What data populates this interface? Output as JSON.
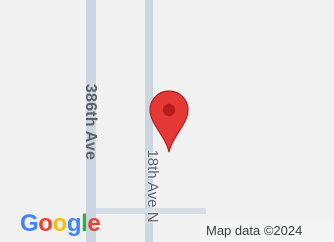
{
  "map": {
    "roads": [
      {
        "name": "386th Ave"
      },
      {
        "name": "18th Ave N"
      }
    ],
    "marker": {
      "icon": "map-pin-icon",
      "color": "#e53935"
    },
    "attribution": "Map data ©2024",
    "logo": {
      "text": "Google",
      "letters": [
        "G",
        "o",
        "o",
        "g",
        "l",
        "e"
      ],
      "colors": [
        "#4285f4",
        "#ea4335",
        "#fbbc05",
        "#4285f4",
        "#34a853",
        "#ea4335"
      ]
    },
    "colors": {
      "background": "#f1f1f1",
      "road": "#ccd6e2",
      "label": "#5f6368"
    }
  }
}
